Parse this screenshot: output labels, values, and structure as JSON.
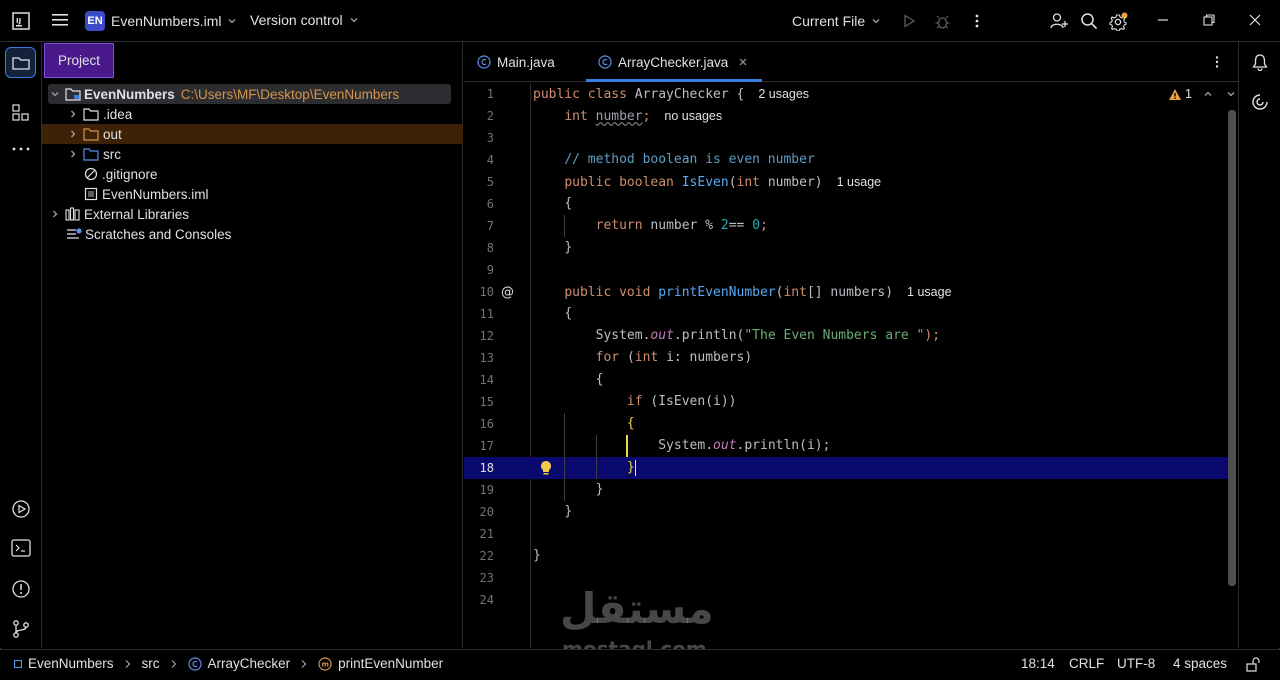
{
  "titlebar": {
    "project_badge": "EN",
    "project_file": "EvenNumbers.iml",
    "vcs_label": "Version control",
    "run_config": "Current File"
  },
  "project_panel": {
    "tab_label": "Project",
    "tree": [
      {
        "label": "EvenNumbers",
        "path": "C:\\Users\\MF\\Desktop\\EvenNumbers",
        "icon": "module-folder-icon"
      },
      {
        "label": ".idea",
        "icon": "folder-icon"
      },
      {
        "label": "out",
        "icon": "folder-icon"
      },
      {
        "label": "src",
        "icon": "source-folder-icon"
      },
      {
        "label": ".gitignore",
        "icon": "ignore-file-icon"
      },
      {
        "label": "EvenNumbers.iml",
        "icon": "module-file-icon"
      },
      {
        "label": "External Libraries",
        "icon": "library-icon"
      },
      {
        "label": "Scratches and Consoles",
        "icon": "scratches-icon"
      }
    ]
  },
  "editor": {
    "tabs": [
      {
        "label": "Main.java",
        "active": false
      },
      {
        "label": "ArrayChecker.java",
        "active": true
      }
    ],
    "warning_count": "1",
    "current_line": 18,
    "line_numbers": [
      "1",
      "2",
      "3",
      "4",
      "5",
      "6",
      "7",
      "8",
      "9",
      "10",
      "11",
      "12",
      "13",
      "14",
      "15",
      "16",
      "17",
      "18",
      "19",
      "20",
      "21",
      "22",
      "23",
      "24"
    ],
    "hints": {
      "class_usages": "2 usages",
      "field_usages": "no usages",
      "iseven_usages": "1 usage",
      "print_usages": "1 usage"
    },
    "code": {
      "l1_kw": "public class ",
      "l1_name": "ArrayChecker",
      "l1_rest": " {",
      "l2_type": "int ",
      "l2_name": "number",
      "l2_rest": ";",
      "l4": "// method boolean is even number",
      "l5_kw": "public boolean ",
      "l5_fn": "IsEven",
      "l5_a": "(",
      "l5_kw2": "int ",
      "l5_b": "number)",
      "l6": "{",
      "l7_kw": "return ",
      "l7_a": "number % ",
      "l7_n1": "2",
      "l7_b": "== ",
      "l7_n2": "0",
      "l7_c": ";",
      "l8": "}",
      "l10_kw": "public void ",
      "l10_fn": "printEvenNumber",
      "l10_a": "(",
      "l10_kw2": "int",
      "l10_b": "[] numbers)",
      "l11": "{",
      "l12_a": "System.",
      "l12_out": "out",
      "l12_b": ".println(",
      "l12_str": "\"The Even Numbers are \"",
      "l12_c": ");",
      "l13_kw": "for ",
      "l13_a": "(",
      "l13_kw2": "int ",
      "l13_b": "i: numbers)",
      "l14": "{",
      "l15_kw": "if ",
      "l15_a": "(IsEven(i))",
      "l16": "{",
      "l17_a": "System.",
      "l17_out": "out",
      "l17_b": ".println(i);",
      "l18": "}",
      "l19": "}",
      "l20": "}",
      "l22": "}"
    }
  },
  "statusbar": {
    "breadcrumb": [
      "EvenNumbers",
      "src",
      "ArrayChecker",
      "printEvenNumber"
    ],
    "position": "18:14",
    "line_ending": "CRLF",
    "encoding": "UTF-8",
    "indent": "4 spaces"
  },
  "watermark": {
    "arabic": "مستقل",
    "latin": "mostaql.com"
  },
  "colors": {
    "accent_purple": "#4a1a8c",
    "current_line_bg": "#0a0a6e",
    "selected_row_bg": "#2b2d30",
    "out_row_bg": "#3d2208"
  }
}
